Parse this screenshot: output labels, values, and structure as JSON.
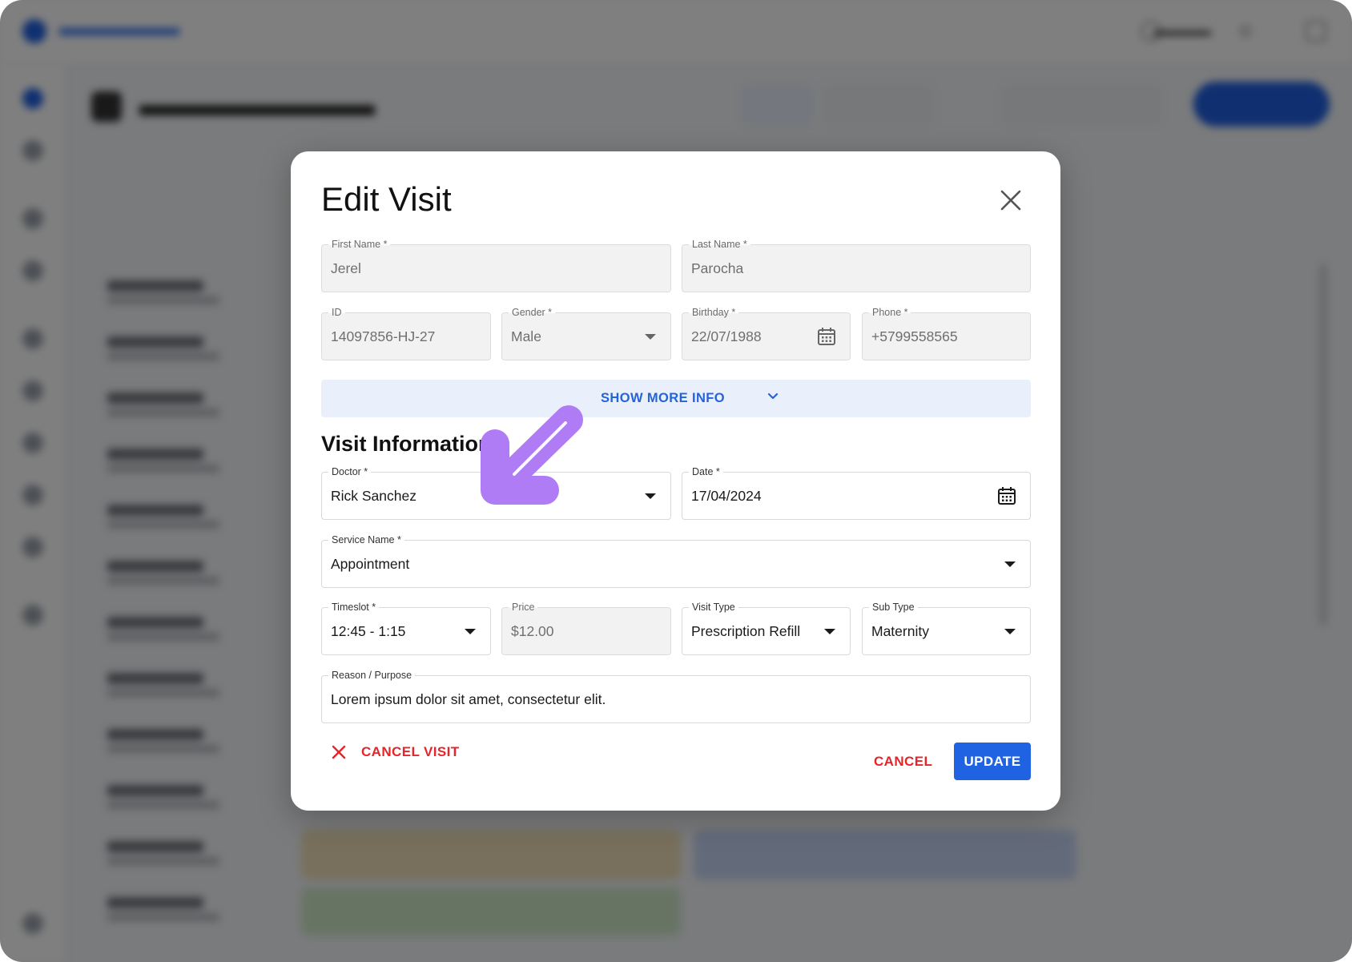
{
  "modal": {
    "title": "Edit Visit",
    "close_icon": "close-icon"
  },
  "patient": {
    "first_name": {
      "label": "First Name *",
      "value": "Jerel"
    },
    "last_name": {
      "label": "Last Name *",
      "value": "Parocha"
    },
    "id": {
      "label": "ID",
      "value": "14097856-HJ-27"
    },
    "gender": {
      "label": "Gender *",
      "value": "Male"
    },
    "birthday": {
      "label": "Birthday *",
      "value": "22/07/1988"
    },
    "phone": {
      "label": "Phone *",
      "value": "+5799558565"
    }
  },
  "show_more": {
    "label": "SHOW MORE INFO",
    "icon": "chevron-down-icon"
  },
  "visit": {
    "section_title": "Visit Information",
    "doctor": {
      "label": "Doctor *",
      "value": "Rick Sanchez"
    },
    "date": {
      "label": "Date *",
      "value": "17/04/2024"
    },
    "service": {
      "label": "Service Name *",
      "value": "Appointment"
    },
    "timeslot": {
      "label": "Timeslot *",
      "value": "12:45 - 1:15"
    },
    "price": {
      "label": "Price",
      "value": "$12.00"
    },
    "visit_type": {
      "label": "Visit Type",
      "value": "Prescription Refill"
    },
    "sub_type": {
      "label": "Sub Type",
      "value": "Maternity"
    },
    "reason": {
      "label": "Reason / Purpose",
      "value": "Lorem ipsum dolor sit amet, consectetur elit."
    }
  },
  "actions": {
    "cancel_visit": "CANCEL VISIT",
    "cancel": "CANCEL",
    "update": "UPDATE"
  },
  "colors": {
    "primary": "#1f63e2",
    "danger": "#e5252a",
    "info_bar": "#e9effb",
    "annotation_arrow": "#b07cf5"
  }
}
